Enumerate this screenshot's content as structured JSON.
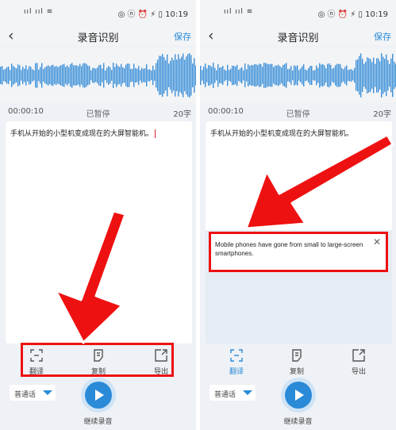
{
  "status_bar": {
    "signal": "ııl ııl ≋",
    "icons_text": "◎ ⓝ ⏰ ⚡ ▯",
    "time": "10:19"
  },
  "header": {
    "title": "录音识别",
    "save_label": "保存"
  },
  "recording": {
    "elapsed": "00:00:10",
    "state": "已暂停",
    "char_count": "20字"
  },
  "transcript": {
    "text": "手机从开始的小型机变成现在的大屏智能机。"
  },
  "translation": {
    "text": "Mobile phones have gone from small to large-screen smartphones."
  },
  "toolbar": {
    "translate_label": "翻译",
    "copy_label": "复制",
    "export_label": "导出"
  },
  "language": {
    "selected": "普通话"
  },
  "controls": {
    "continue_label": "继续录音"
  },
  "colors": {
    "accent": "#2a8bd6",
    "highlight": "#ee1111",
    "waveform": "#3b8fd8"
  },
  "icons": [
    "back-icon",
    "translate-icon",
    "copy-icon",
    "export-icon",
    "close-icon",
    "play-icon",
    "dropdown-caret-icon"
  ]
}
